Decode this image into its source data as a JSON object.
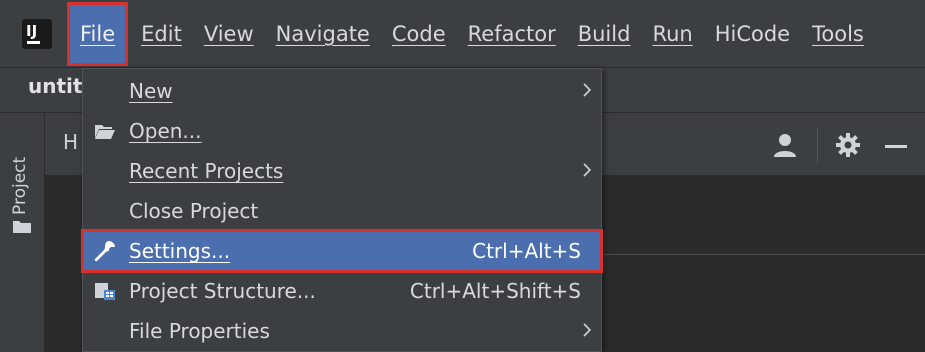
{
  "app": {
    "logo_text": "IJ"
  },
  "menubar": {
    "items": [
      {
        "label": "File",
        "active": true
      },
      {
        "label": "Edit"
      },
      {
        "label": "View"
      },
      {
        "label": "Navigate"
      },
      {
        "label": "Code"
      },
      {
        "label": "Refactor"
      },
      {
        "label": "Build"
      },
      {
        "label": "Run"
      },
      {
        "label": "HiCode"
      },
      {
        "label": "Tools"
      }
    ]
  },
  "titlebar": {
    "project_name": "untit"
  },
  "left_stripe": {
    "project_tab": "Project"
  },
  "editor_header": {
    "text": "H"
  },
  "file_menu": {
    "items": [
      {
        "label": "New",
        "shortcut": "",
        "has_submenu": true,
        "icon": ""
      },
      {
        "label": "Open...",
        "shortcut": "",
        "has_submenu": false,
        "icon": "folder-open-icon"
      },
      {
        "label": "Recent Projects",
        "shortcut": "",
        "has_submenu": true,
        "icon": ""
      },
      {
        "label": "Close Project",
        "shortcut": "",
        "has_submenu": false,
        "icon": ""
      },
      {
        "label": "Settings...",
        "shortcut": "Ctrl+Alt+S",
        "has_submenu": false,
        "icon": "wrench-icon",
        "selected": true
      },
      {
        "label": "Project Structure...",
        "shortcut": "Ctrl+Alt+Shift+S",
        "has_submenu": false,
        "icon": "project-structure-icon"
      },
      {
        "label": "File Properties",
        "shortcut": "",
        "has_submenu": true,
        "icon": ""
      }
    ]
  },
  "colors": {
    "selection": "#4b6eaf",
    "highlight_border": "#d8302d",
    "background": "#3c3f41"
  }
}
